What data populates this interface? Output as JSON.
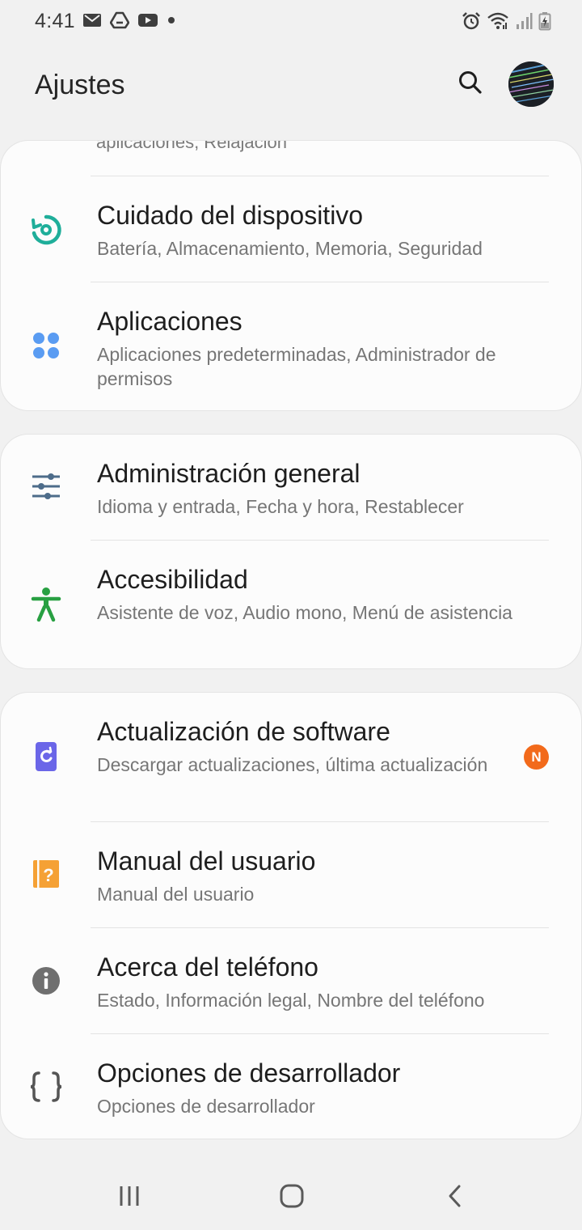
{
  "status_bar": {
    "time": "4:41",
    "left_icons": [
      "mail-icon",
      "drive-icon",
      "youtube-icon",
      "dot-icon"
    ],
    "right_icons": [
      "alarm-icon",
      "wifi-icon",
      "signal-icon",
      "battery-charging-icon"
    ]
  },
  "header": {
    "title": "Ajustes",
    "search_icon": "search-icon",
    "avatar": "profile-avatar"
  },
  "groups": [
    {
      "partial_subtitle": "aplicaciones, Relajación",
      "items": [
        {
          "title": "Cuidado del dispositivo",
          "subtitle": "Batería, Almacenamiento, Memoria, Seguridad",
          "icon": "device-care-icon",
          "color": "#1fae9a"
        },
        {
          "title": "Aplicaciones",
          "subtitle": "Aplicaciones predeterminadas, Administrador de permisos",
          "icon": "apps-icon",
          "color": "#5a9cf2"
        }
      ]
    },
    {
      "items": [
        {
          "title": "Administración general",
          "subtitle": "Idioma y entrada, Fecha y hora, Restablecer",
          "icon": "sliders-icon",
          "color": "#4d6c8a"
        },
        {
          "title": "Accesibilidad",
          "subtitle": "Asistente de voz, Audio mono, Menú de asistencia",
          "icon": "accessibility-icon",
          "color": "#28a042"
        }
      ]
    },
    {
      "items": [
        {
          "title": "Actualización de software",
          "subtitle": "Descargar actualizaciones, última actualización",
          "icon": "software-update-icon",
          "color": "#6b66e8",
          "badge": "N"
        },
        {
          "title": "Manual del usuario",
          "subtitle": "Manual del usuario",
          "icon": "user-manual-icon",
          "color": "#f5a135"
        },
        {
          "title": "Acerca del teléfono",
          "subtitle": "Estado, Información legal, Nombre del teléfono",
          "icon": "info-icon",
          "color": "#6f6f6f"
        },
        {
          "title": "Opciones de desarrollador",
          "subtitle": "Opciones de desarrollador",
          "icon": "braces-icon",
          "color": "#555555"
        }
      ]
    }
  ],
  "badge_color": "#f26a1b",
  "nav_bar": {
    "buttons": [
      "recent-apps-icon",
      "home-icon",
      "back-icon"
    ]
  }
}
